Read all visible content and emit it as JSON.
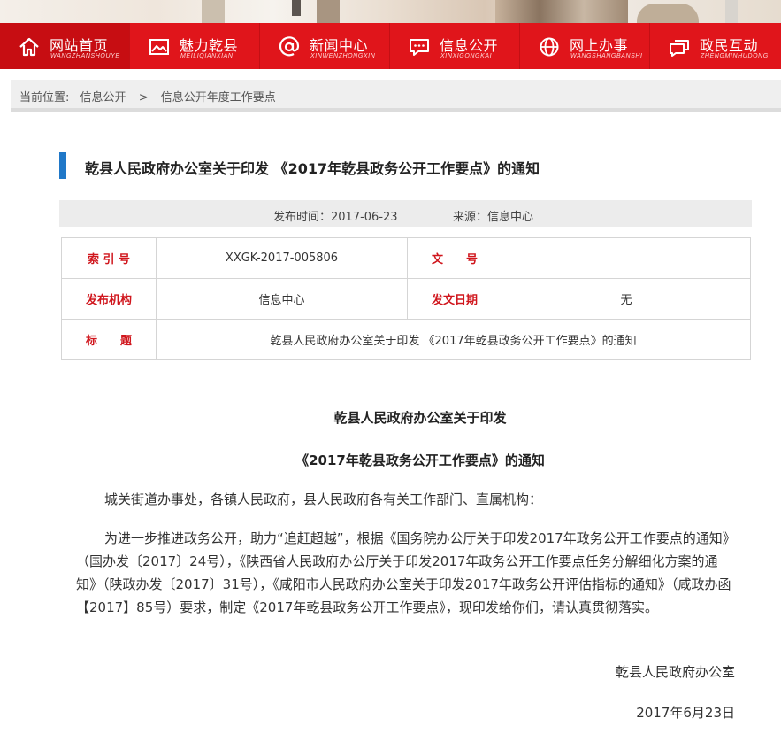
{
  "nav": {
    "items": [
      {
        "label": "网站首页",
        "sub": "WANGZHANSHOUYE",
        "icon": "home-icon"
      },
      {
        "label": "魅力乾县",
        "sub": "MEILIQIANXIAN",
        "icon": "picture-icon"
      },
      {
        "label": "新闻中心",
        "sub": "XINWENZHONGXIN",
        "icon": "at-icon"
      },
      {
        "label": "信息公开",
        "sub": "XINXIGONGKAI",
        "icon": "chat-icon"
      },
      {
        "label": "网上办事",
        "sub": "WANGSHANGBANSHI",
        "icon": "globe-icon"
      },
      {
        "label": "政民互动",
        "sub": "ZHENGMINHUDONG",
        "icon": "speech-icon"
      }
    ]
  },
  "breadcrumb": {
    "prefix": "当前位置:",
    "items": [
      "信息公开",
      "信息公开年度工作要点"
    ],
    "separator": ">"
  },
  "article": {
    "title": "乾县人民政府办公室关于印发 《2017年乾县政务公开工作要点》的通知",
    "publish_time": "发布时间：2017-06-23",
    "source": "来源：信息中心",
    "heading_line1": "乾县人民政府办公室关于印发",
    "heading_line2": "《2017年乾县政务公开工作要点》的通知",
    "greeting": "城关街道办事处，各镇人民政府，县人民政府各有关工作部门、直属机构：",
    "body": "为进一步推进政务公开，助力“追赶超越”，根据《国务院办公厅关于印发2017年政务公开工作要点的通知》（国办发〔2017〕24号），《陕西省人民政府办公厅关于印发2017年政务公开工作要点任务分解细化方案的通知》（陕政办发〔2017〕31号），《咸阳市人民政府办公室关于印发2017年政务公开评估指标的通知》（咸政办函【2017】85号）要求，制定《2017年乾县政务公开工作要点》，现印发给你们，请认真贯彻落实。",
    "signature": "乾县人民政府办公室",
    "date": "2017年6月23日"
  },
  "info_table": {
    "index_label": "索 引 号",
    "index_value": "XXGK-2017-005806",
    "doc_no_label": "文　　号",
    "doc_no_value": "",
    "org_label": "发布机构",
    "org_value": "信息中心",
    "date_label": "发文日期",
    "date_value": "无",
    "title_label": "标　　题",
    "title_value": "乾县人民政府办公室关于印发 《2017年乾县政务公开工作要点》的通知"
  },
  "colors": {
    "nav_bg": "#e0151b",
    "nav_active": "#c70d12",
    "label_red": "#d0161d",
    "title_accent": "#2078c8"
  }
}
